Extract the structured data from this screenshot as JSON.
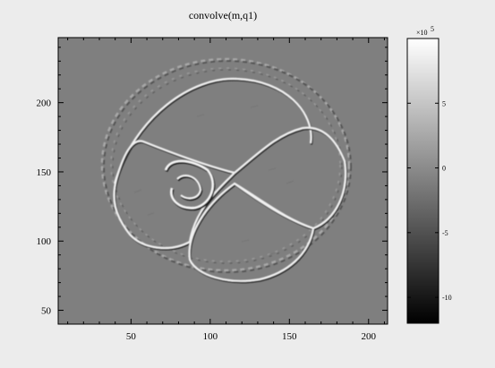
{
  "chart_data": {
    "type": "heatmap",
    "title": "convolve(m,q1)",
    "xlabel": "",
    "ylabel": "",
    "xlim": [
      4,
      212
    ],
    "ylim": [
      40,
      247
    ],
    "x_ticks": [
      50,
      100,
      150,
      200
    ],
    "y_ticks": [
      50,
      100,
      150,
      200
    ],
    "colorbar": {
      "colormap": "gray",
      "exponent_label": "×10",
      "exponent_power": "5",
      "range": [
        -12,
        10
      ],
      "ticks": [
        {
          "value": 5,
          "label": "5"
        },
        {
          "value": 0,
          "label": "0"
        },
        {
          "value": -5,
          "label": "-5"
        },
        {
          "value": -10,
          "label": "-10"
        }
      ]
    },
    "description_values": {
      "background_level": 0,
      "edge_highlight": 8,
      "edge_shadow": -10
    }
  },
  "colors": {
    "page_bg": "#ececec",
    "image_bg": "#7f7f7f",
    "edge_light": "#f2f2f2",
    "edge_dark": "#262626"
  }
}
